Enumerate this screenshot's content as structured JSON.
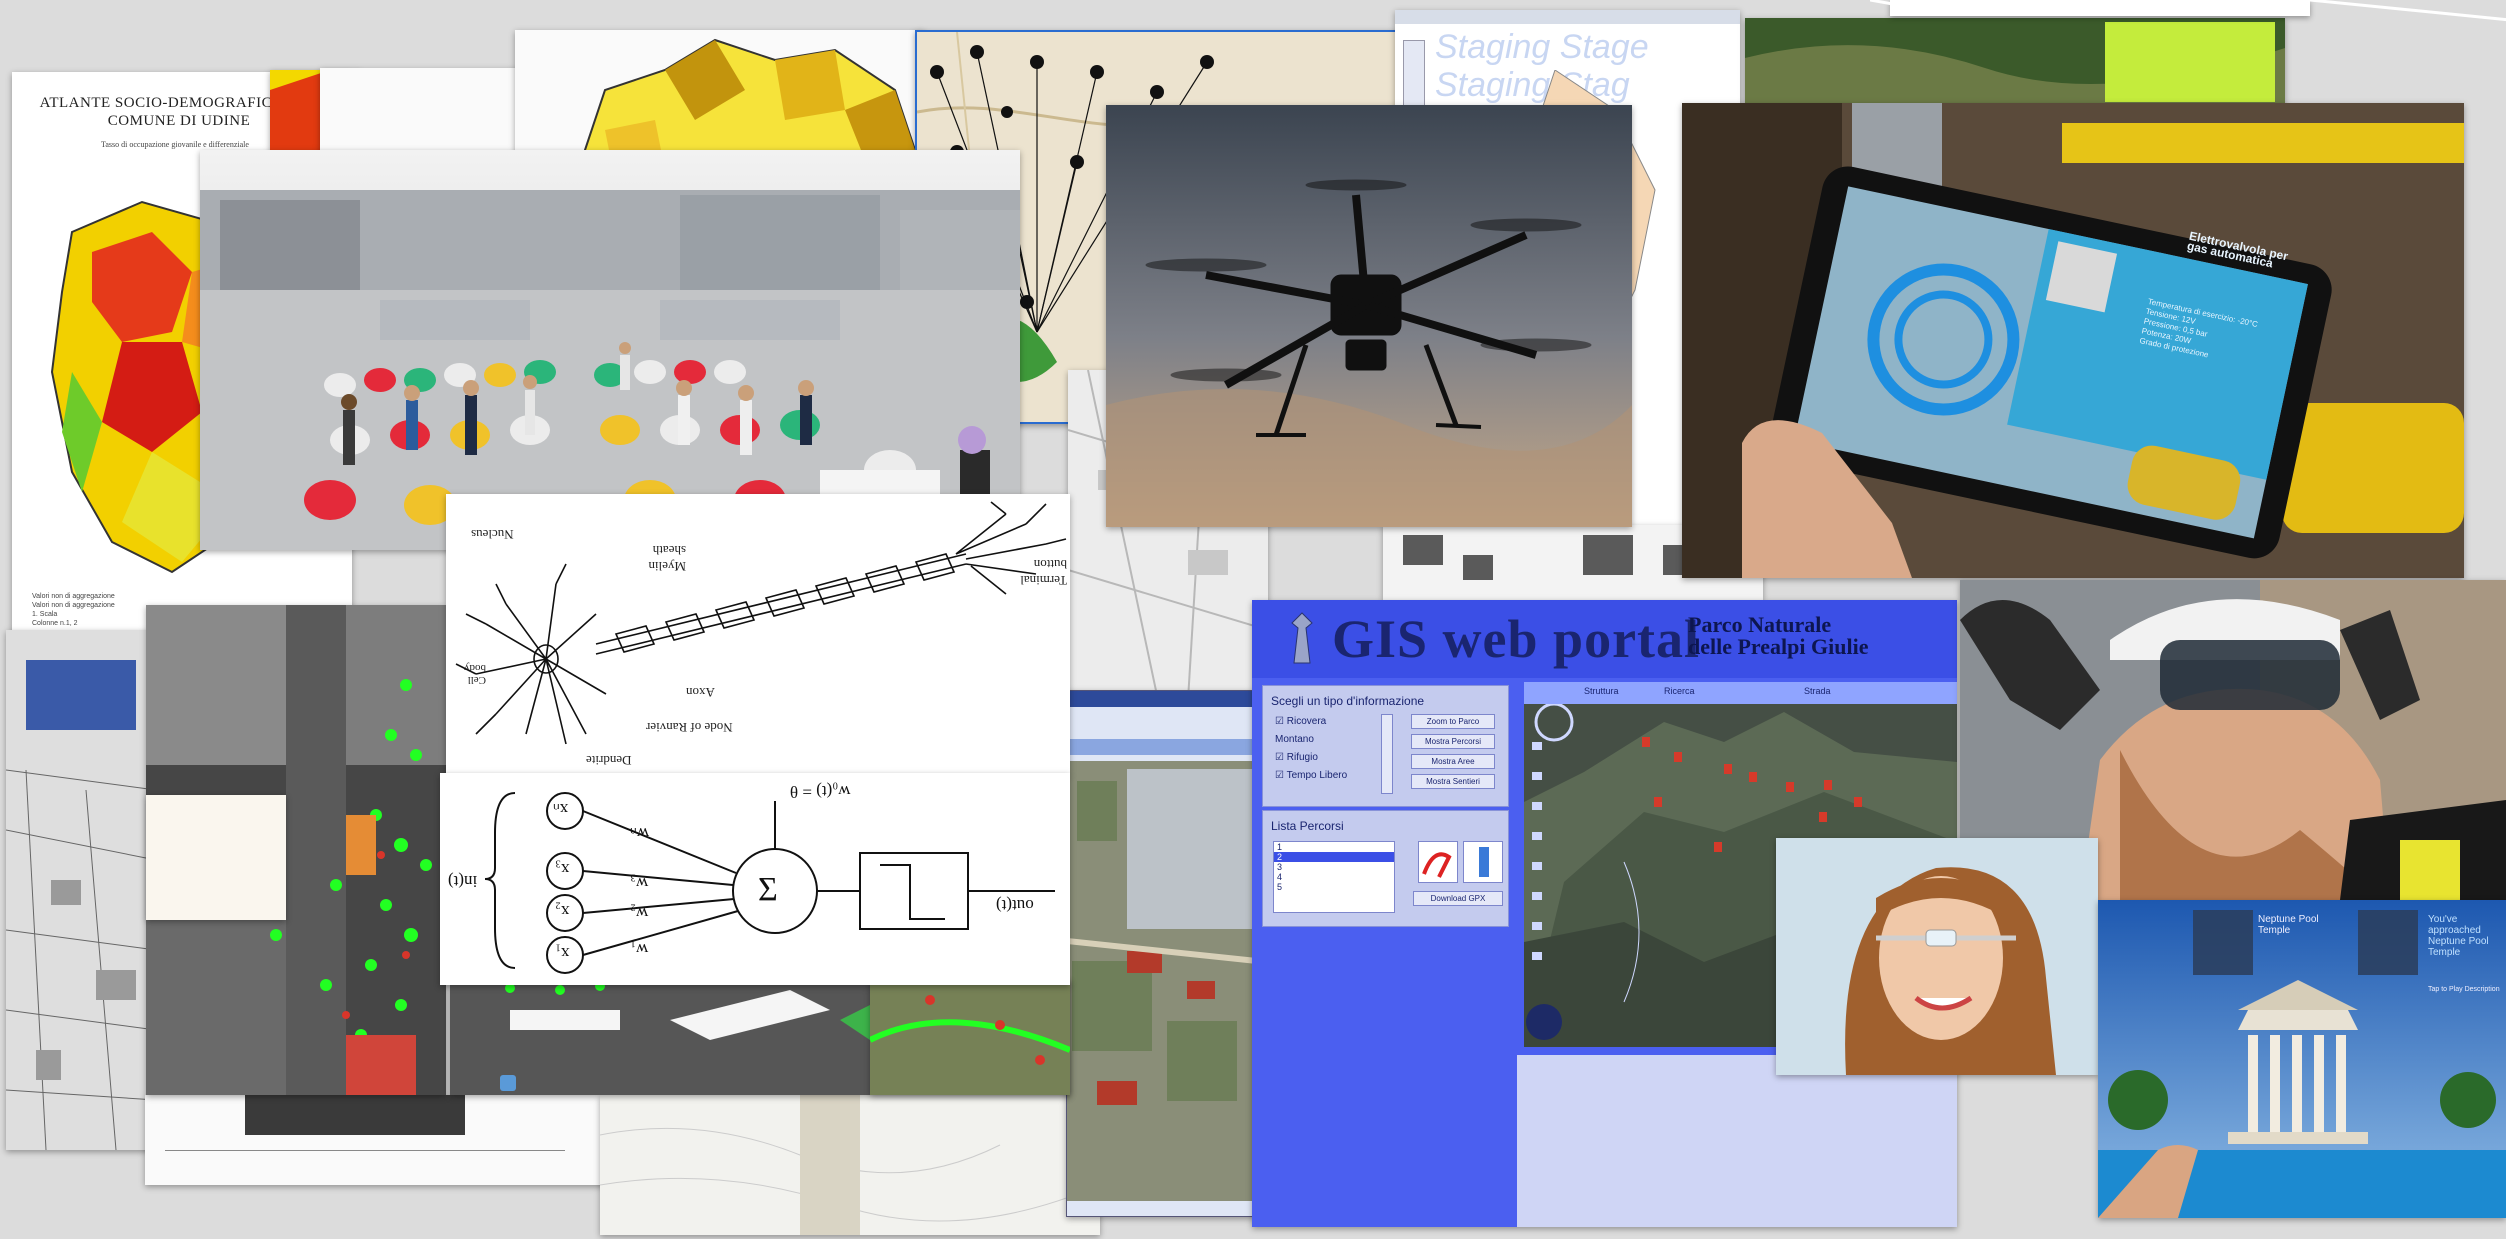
{
  "atlas": {
    "title": "ATLANTE SOCIO-DEMOGRAFICO DEL COMUNE DI UDINE",
    "subtitle": "Tasso di occupazione giovanile e differenziale",
    "legend": [
      "Valori non di aggregazione",
      "Valori non di aggregazione",
      "1. Scala",
      "Colonne n.1, 2"
    ]
  },
  "staging": {
    "text": "Staging Stage Staging Stag"
  },
  "gis": {
    "title": "GIS web portal",
    "subtitle_line1": "Parco Naturale",
    "subtitle_line2": "delle Prealpi Giulie",
    "panel1": {
      "title": "Scegli un tipo d'informazione",
      "options": [
        "Ricovera",
        "Montano",
        "Rifugio",
        "Tempo Libero"
      ],
      "buttons": [
        "Zoom to Parco",
        "Mostra Percorsi",
        "Mostra Aree",
        "Mostra Sentieri"
      ]
    },
    "panel2": {
      "title": "Lista Percorsi",
      "rows": [
        "1",
        "2",
        "3",
        "4",
        "5"
      ],
      "download": "Download GPX"
    },
    "map_toolbar": [
      "Struttura",
      "Ricerca",
      "Strada"
    ]
  },
  "neuron": {
    "labels": [
      "Nucleus",
      "Myelin sheath",
      "Axon",
      "Node of Ranvier",
      "Dendrite",
      "Terminal button",
      "Cell body"
    ]
  },
  "perceptron": {
    "inputs": [
      "x₁",
      "x₂",
      "x₃",
      "xₙ"
    ],
    "weights": [
      "w₁",
      "w₂",
      "w₃",
      "wₙ"
    ],
    "in_label": "in(t)",
    "out_label": "out(t)",
    "theta": "w₀(t) = θ",
    "sum": "Σ"
  },
  "tablet": {
    "title": "Elettrovalvola per gas automatica",
    "specs": [
      "Temperatura di esercizio: -20°C",
      "Tensione: 12V",
      "Pressione: 0,5 bar",
      "Potenza: 20W",
      "Grado di protezione"
    ]
  },
  "neptune": {
    "card1": "Neptune Pool Temple",
    "card2": "You've approached Neptune Pool Temple",
    "hint": "Tap to Play Description"
  },
  "colors": {
    "gis_bg": "#4b5ff0",
    "gis_title": "#1a2570",
    "neon_green": "#22ff22"
  }
}
